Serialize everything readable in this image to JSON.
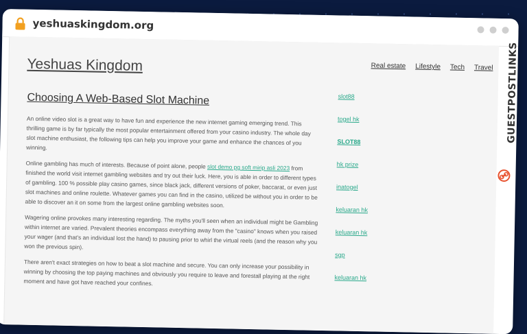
{
  "browser": {
    "url": "yeshuaskingdom.org"
  },
  "site": {
    "title": "Yeshuas Kingdom",
    "nav": [
      "Real estate",
      "Lifestyle",
      "Tech",
      "Travel"
    ]
  },
  "article": {
    "title": "Choosing A Web-Based Slot Machine",
    "p1": "An online video slot is a great way to have fun and experience the new internet gaming emerging trend. This thrilling game is by far typically the most popular entertainment offered from your casino industry. The whole day slot machine enthusiast, the following tips can help you improve your game and enhance the chances of you winning.",
    "p2_before": "Online gambling has much of interests. Because of point alone, people ",
    "p2_link": "slot demo pg soft mirip asli 2023",
    "p2_after": " from finished the world visit internet gambling websites and try out their luck. Here, you is able in order to different types of gambling. 100 % possible play casino games, since black jack, different versions of poker, baccarat, or even just slot machines and online roulette. Whatever games you can find in the casino, utilized be without you in order to be able to discover an it on some from the largest online gambling websites soon.",
    "p3": "Wagering online provokes many interesting regarding. The myths you'll seen when an individual might be Gambling within internet are varied. Prevalent theories encompass everything away from the \"casino\" knows when you raised your wager (and that's an individual lost the hand) to pausing prior to whirl the virtual reels (and the reason why you won the previous spin).",
    "p4": "There aren't exact strategies on how to beat a slot machine and secure. You can only increase your possibility in winning by choosing the top paying machines and obviously you require to leave and forestall playing at the right moment and have got have reached your confines."
  },
  "sidebar": {
    "links": [
      "slot88",
      "togel hk",
      "SLOT88",
      "hk prize",
      "inatogel",
      "keluaran hk",
      "keluaran hk",
      "sgp",
      "keluaran hk"
    ]
  },
  "watermark": {
    "text": "GUESTPOSTLINKS"
  },
  "colors": {
    "background": "#0b1b3f",
    "link": "#2aa98b",
    "lock": "#f2a020",
    "brand": "#e8522e"
  }
}
